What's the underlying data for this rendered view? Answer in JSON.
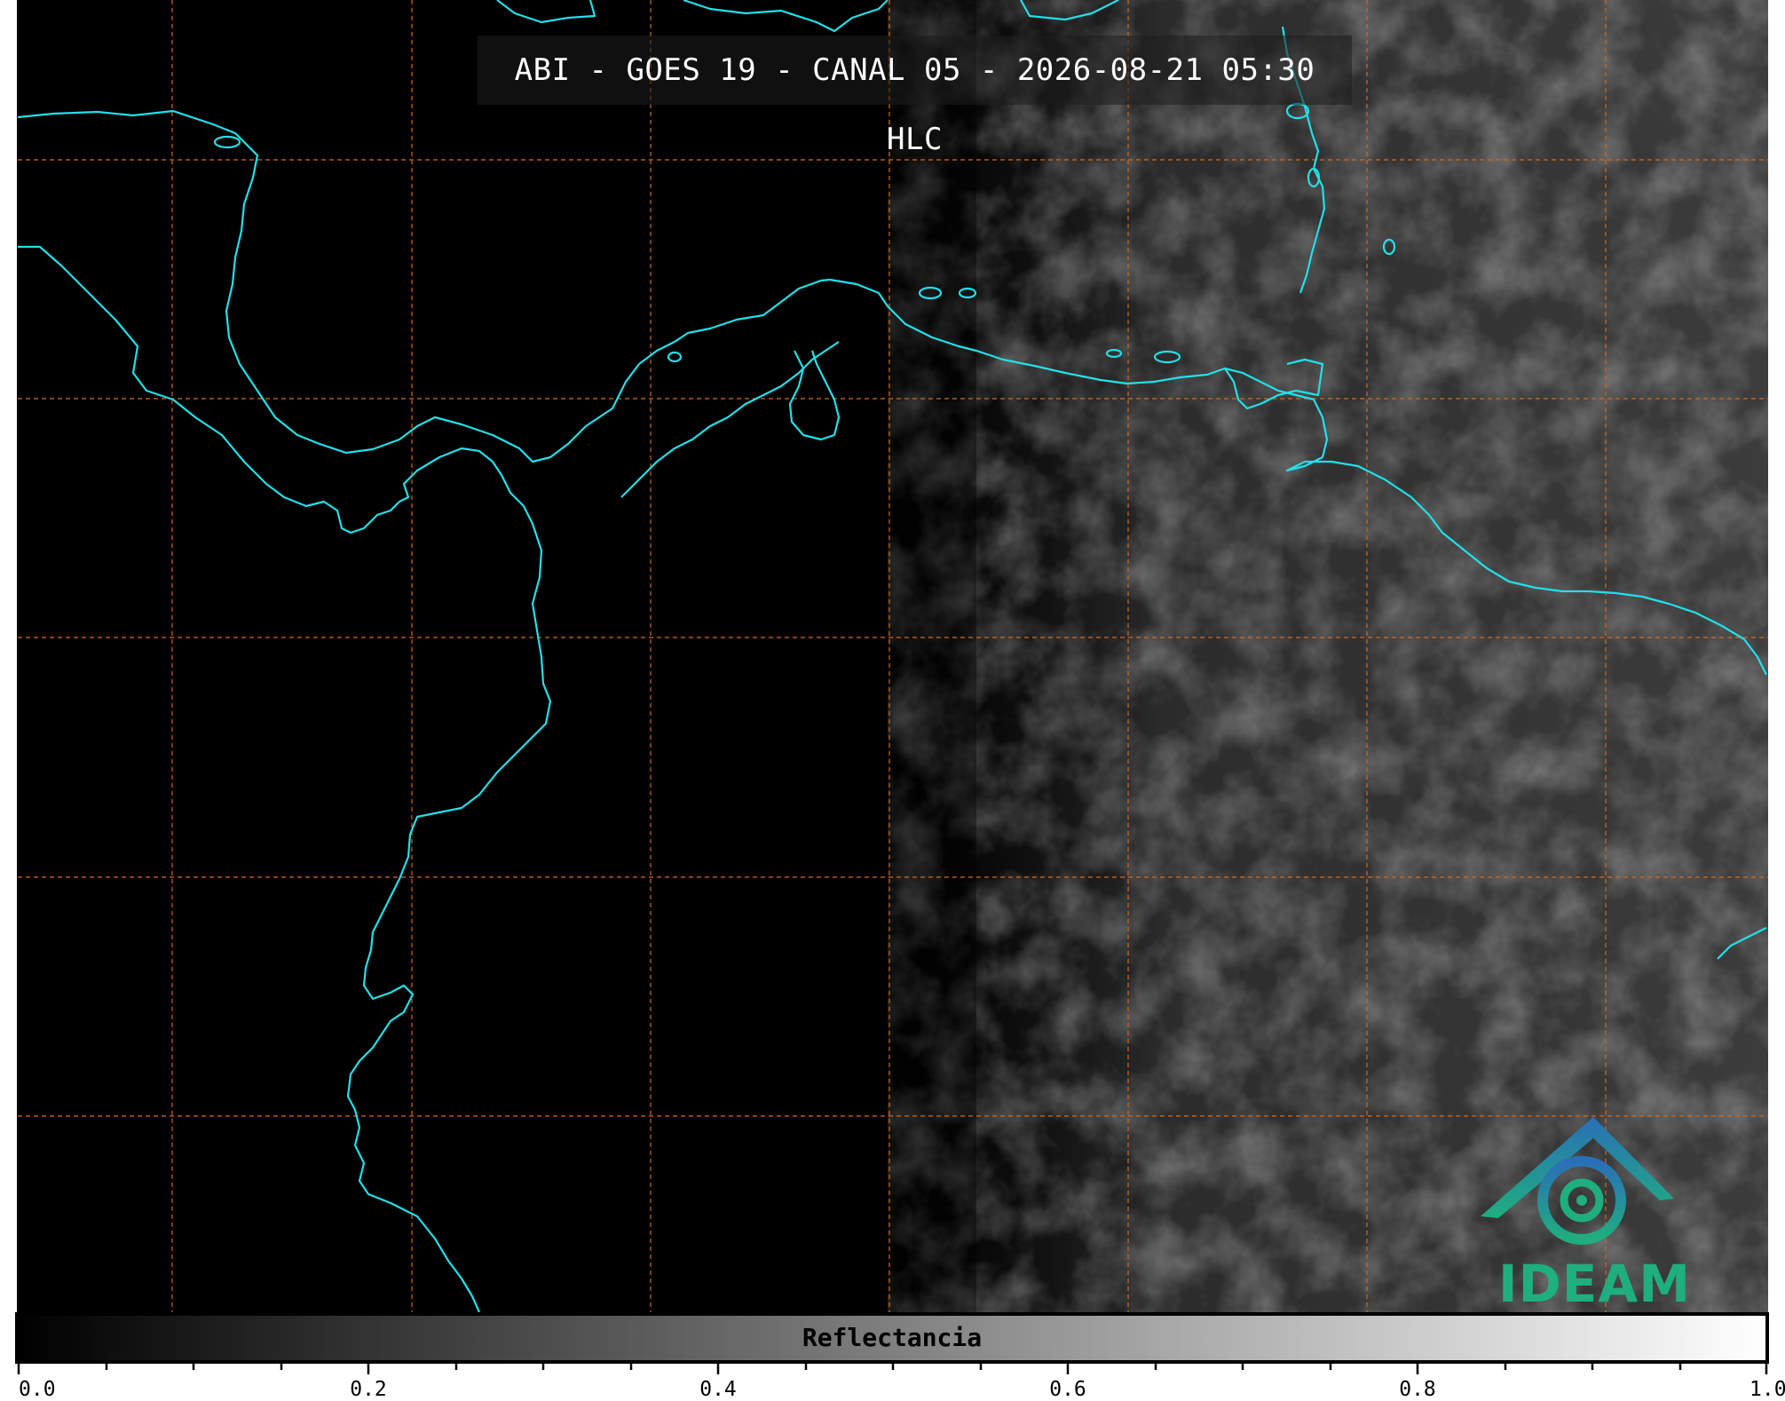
{
  "title": "ABI - GOES 19 - CANAL 05 - 2026-08-21 05:30 HLC",
  "colorbar": {
    "label": "Reflectancia",
    "ticks": [
      "0.0",
      "0.2",
      "0.4",
      "0.6",
      "0.8",
      "1.0"
    ]
  },
  "logo": {
    "text": "IDEAM"
  },
  "colors": {
    "coastline": "#22e0e8",
    "gridline": "#d2691e",
    "background": "#000000",
    "logo_green": "#1fae7e",
    "logo_blue": "#2a6fb8"
  }
}
